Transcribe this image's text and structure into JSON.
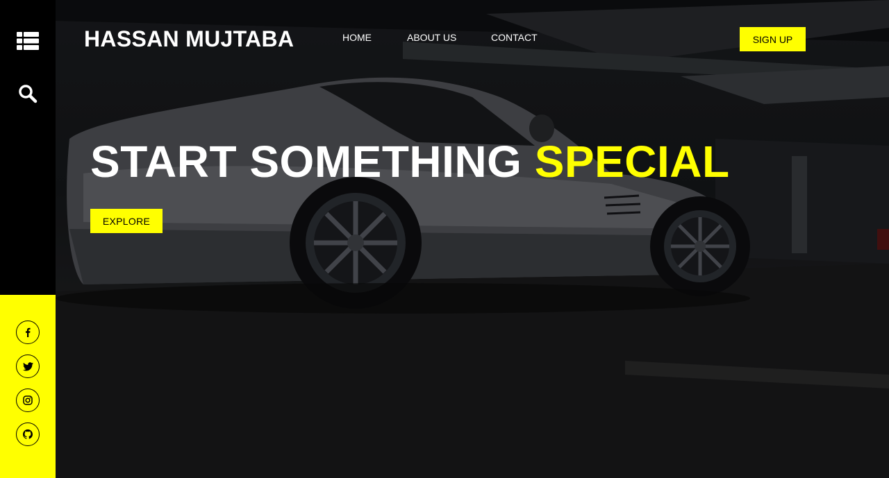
{
  "brand": {
    "name": "HASSAN MUJTABA"
  },
  "nav": {
    "items": [
      {
        "label": "HOME"
      },
      {
        "label": "ABOUT US"
      },
      {
        "label": "CONTACT"
      }
    ]
  },
  "header": {
    "signup_label": "SIGN UP"
  },
  "hero": {
    "headline_main": "START SOMETHING ",
    "headline_accent": "SPECIAL",
    "cta_label": "EXPLORE"
  },
  "sidebar": {
    "icons": [
      "menu-icon",
      "search-icon"
    ],
    "social": [
      "facebook-icon",
      "twitter-icon",
      "instagram-icon",
      "github-icon"
    ]
  },
  "colors": {
    "accent": "#ffff00",
    "sidebar": "#000000",
    "text": "#ffffff"
  }
}
